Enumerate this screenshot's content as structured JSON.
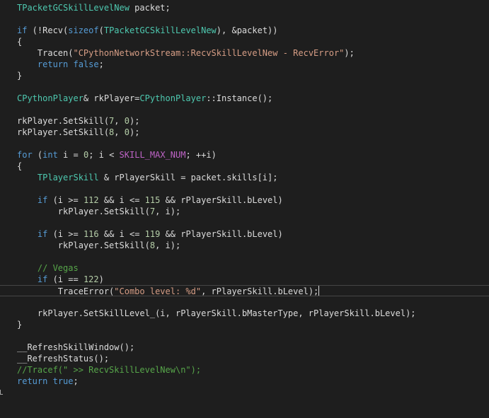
{
  "lines": [
    [
      {
        "t": "TPacketGCSkillLevelNew",
        "c": "ty"
      },
      {
        "t": " packet;",
        "c": "pl"
      }
    ],
    [],
    [
      {
        "t": "if",
        "c": "kw"
      },
      {
        "t": " (!Recv(",
        "c": "pl"
      },
      {
        "t": "sizeof",
        "c": "kw"
      },
      {
        "t": "(",
        "c": "pl"
      },
      {
        "t": "TPacketGCSkillLevelNew",
        "c": "ty"
      },
      {
        "t": "), &packet))",
        "c": "pl"
      }
    ],
    [
      {
        "t": "{",
        "c": "pl"
      }
    ],
    [
      {
        "t": "    Tracen(",
        "c": "pl"
      },
      {
        "t": "\"CPythonNetworkStream::RecvSkillLevelNew - RecvError\"",
        "c": "str"
      },
      {
        "t": ");",
        "c": "pl"
      }
    ],
    [
      {
        "t": "    ",
        "c": "pl"
      },
      {
        "t": "return",
        "c": "kw"
      },
      {
        "t": " ",
        "c": "pl"
      },
      {
        "t": "false",
        "c": "kw"
      },
      {
        "t": ";",
        "c": "pl"
      }
    ],
    [
      {
        "t": "}",
        "c": "pl"
      }
    ],
    [],
    [
      {
        "t": "CPythonPlayer",
        "c": "ty"
      },
      {
        "t": "& rkPlayer=",
        "c": "pl"
      },
      {
        "t": "CPythonPlayer",
        "c": "ty"
      },
      {
        "t": "::Instance();",
        "c": "pl"
      }
    ],
    [],
    [
      {
        "t": "rkPlayer.SetSkill(",
        "c": "pl"
      },
      {
        "t": "7",
        "c": "num"
      },
      {
        "t": ", ",
        "c": "pl"
      },
      {
        "t": "0",
        "c": "num"
      },
      {
        "t": ");",
        "c": "pl"
      }
    ],
    [
      {
        "t": "rkPlayer.SetSkill(",
        "c": "pl"
      },
      {
        "t": "8",
        "c": "num"
      },
      {
        "t": ", ",
        "c": "pl"
      },
      {
        "t": "0",
        "c": "num"
      },
      {
        "t": ");",
        "c": "pl"
      }
    ],
    [],
    [
      {
        "t": "for",
        "c": "kw"
      },
      {
        "t": " (",
        "c": "pl"
      },
      {
        "t": "int",
        "c": "kw"
      },
      {
        "t": " i = ",
        "c": "pl"
      },
      {
        "t": "0",
        "c": "num"
      },
      {
        "t": "; i < ",
        "c": "pl"
      },
      {
        "t": "SKILL_MAX_NUM",
        "c": "mac"
      },
      {
        "t": "; ++i)",
        "c": "pl"
      }
    ],
    [
      {
        "t": "{",
        "c": "pl"
      }
    ],
    [
      {
        "t": "    ",
        "c": "pl"
      },
      {
        "t": "TPlayerSkill",
        "c": "ty"
      },
      {
        "t": " & rPlayerSkill = packet.skills[i];",
        "c": "pl"
      }
    ],
    [],
    [
      {
        "t": "    ",
        "c": "pl"
      },
      {
        "t": "if",
        "c": "kw"
      },
      {
        "t": " (i >= ",
        "c": "pl"
      },
      {
        "t": "112",
        "c": "num"
      },
      {
        "t": " && i <= ",
        "c": "pl"
      },
      {
        "t": "115",
        "c": "num"
      },
      {
        "t": " && rPlayerSkill.bLevel)",
        "c": "pl"
      }
    ],
    [
      {
        "t": "        rkPlayer.SetSkill(",
        "c": "pl"
      },
      {
        "t": "7",
        "c": "num"
      },
      {
        "t": ", i);",
        "c": "pl"
      }
    ],
    [],
    [
      {
        "t": "    ",
        "c": "pl"
      },
      {
        "t": "if",
        "c": "kw"
      },
      {
        "t": " (i >= ",
        "c": "pl"
      },
      {
        "t": "116",
        "c": "num"
      },
      {
        "t": " && i <= ",
        "c": "pl"
      },
      {
        "t": "119",
        "c": "num"
      },
      {
        "t": " && rPlayerSkill.bLevel)",
        "c": "pl"
      }
    ],
    [
      {
        "t": "        rkPlayer.SetSkill(",
        "c": "pl"
      },
      {
        "t": "8",
        "c": "num"
      },
      {
        "t": ", i);",
        "c": "pl"
      }
    ],
    [],
    [
      {
        "t": "    ",
        "c": "pl"
      },
      {
        "t": "// Vegas",
        "c": "cm"
      }
    ],
    [
      {
        "t": "    ",
        "c": "pl"
      },
      {
        "t": "if",
        "c": "kw"
      },
      {
        "t": " (i == ",
        "c": "pl"
      },
      {
        "t": "122",
        "c": "num"
      },
      {
        "t": ")",
        "c": "pl"
      }
    ],
    [
      {
        "t": "        TraceError(",
        "c": "pl"
      },
      {
        "t": "\"Combo level: %d\"",
        "c": "str"
      },
      {
        "t": ", rPlayerSkill.bLevel);",
        "c": "pl"
      }
    ],
    [],
    [
      {
        "t": "    rkPlayer.SetSkillLevel_(i, rPlayerSkill.bMasterType, rPlayerSkill.bLevel);",
        "c": "pl"
      }
    ],
    [
      {
        "t": "}",
        "c": "pl"
      }
    ],
    [],
    [
      {
        "t": "__RefreshSkillWindow();",
        "c": "pl"
      }
    ],
    [
      {
        "t": "__RefreshStatus();",
        "c": "pl"
      }
    ],
    [
      {
        "t": "//Tracef(\" >> RecvSkillLevelNew\\n\");",
        "c": "cm"
      }
    ],
    [
      {
        "t": "return",
        "c": "kw"
      },
      {
        "t": " ",
        "c": "pl"
      },
      {
        "t": "true",
        "c": "kw"
      },
      {
        "t": ";",
        "c": "pl"
      }
    ]
  ],
  "current_line": 25,
  "colors": {
    "background": "#1e1e1e",
    "keyword": "#569cd6",
    "type": "#4ec9b0",
    "string": "#d69d85",
    "number": "#b5cea8",
    "comment": "#57a64a",
    "macro": "#bd63c5",
    "plain": "#dcdcdc"
  }
}
